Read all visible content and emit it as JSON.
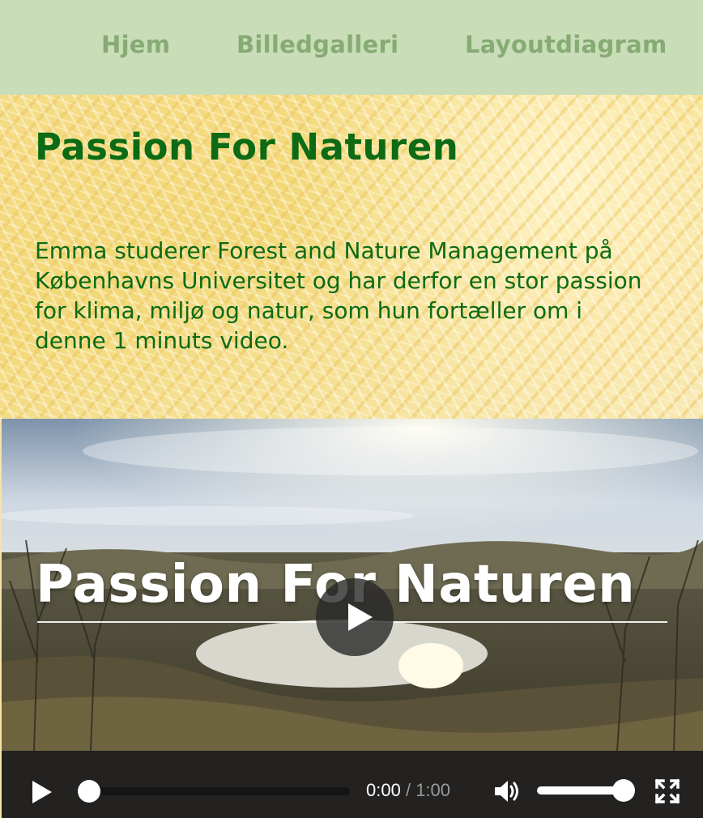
{
  "nav": {
    "items": [
      {
        "label": "Hjem"
      },
      {
        "label": "Billedgalleri"
      },
      {
        "label": "Layoutdiagram"
      }
    ]
  },
  "hero": {
    "title": "Passion For Naturen",
    "text": "Emma studerer Forest and Nature Management på Københavns Universitet og har derfor en stor passion for klima, miljø og natur, som hun fortæller om i denne 1 minuts video."
  },
  "video": {
    "overlay_title": "Passion For Naturen",
    "current_time": "0:00",
    "separator": "/",
    "duration": "1:00",
    "progress": 0.0,
    "volume": 1.0,
    "icons": {
      "big_play": "play-icon",
      "play": "play-icon",
      "volume": "volume-icon",
      "fullscreen": "fullscreen-icon"
    }
  },
  "colors": {
    "nav_background": "#c9ddb8",
    "nav_text": "#86ab73",
    "heading_green": "#0c6b14",
    "controls_background": "#212121"
  }
}
